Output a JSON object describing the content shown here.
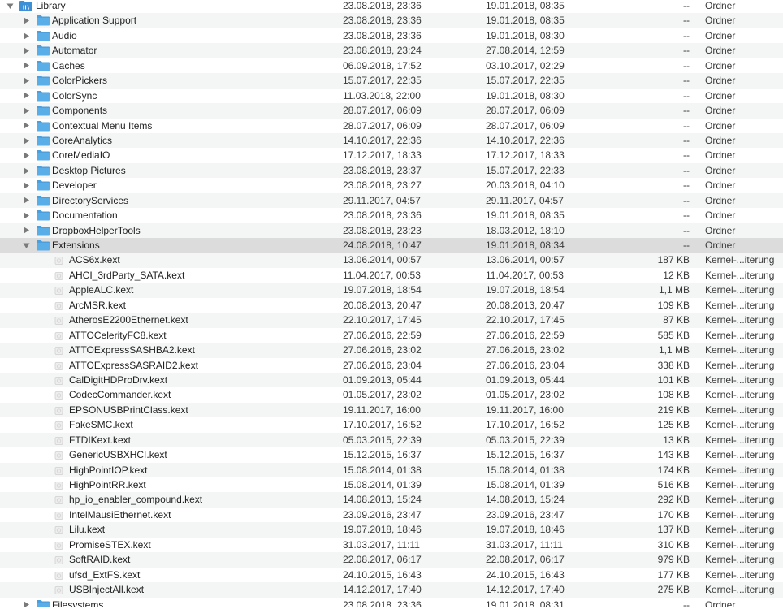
{
  "rows": [
    {
      "level": 0,
      "type": "folder",
      "expanded": true,
      "name": "Library",
      "modified": "23.08.2018, 23:36",
      "created": "19.01.2018, 08:35",
      "size": "--",
      "kind": "Ordner"
    },
    {
      "level": 1,
      "type": "folder",
      "expanded": false,
      "name": "Application Support",
      "modified": "23.08.2018, 23:36",
      "created": "19.01.2018, 08:35",
      "size": "--",
      "kind": "Ordner"
    },
    {
      "level": 1,
      "type": "folder",
      "expanded": false,
      "name": "Audio",
      "modified": "23.08.2018, 23:36",
      "created": "19.01.2018, 08:30",
      "size": "--",
      "kind": "Ordner"
    },
    {
      "level": 1,
      "type": "folder",
      "expanded": false,
      "name": "Automator",
      "modified": "23.08.2018, 23:24",
      "created": "27.08.2014, 12:59",
      "size": "--",
      "kind": "Ordner"
    },
    {
      "level": 1,
      "type": "folder",
      "expanded": false,
      "name": "Caches",
      "modified": "06.09.2018, 17:52",
      "created": "03.10.2017, 02:29",
      "size": "--",
      "kind": "Ordner"
    },
    {
      "level": 1,
      "type": "folder",
      "expanded": false,
      "name": "ColorPickers",
      "modified": "15.07.2017, 22:35",
      "created": "15.07.2017, 22:35",
      "size": "--",
      "kind": "Ordner"
    },
    {
      "level": 1,
      "type": "folder",
      "expanded": false,
      "name": "ColorSync",
      "modified": "11.03.2018, 22:00",
      "created": "19.01.2018, 08:30",
      "size": "--",
      "kind": "Ordner"
    },
    {
      "level": 1,
      "type": "folder",
      "expanded": false,
      "name": "Components",
      "modified": "28.07.2017, 06:09",
      "created": "28.07.2017, 06:09",
      "size": "--",
      "kind": "Ordner"
    },
    {
      "level": 1,
      "type": "folder",
      "expanded": false,
      "name": "Contextual Menu Items",
      "modified": "28.07.2017, 06:09",
      "created": "28.07.2017, 06:09",
      "size": "--",
      "kind": "Ordner"
    },
    {
      "level": 1,
      "type": "folder",
      "expanded": false,
      "name": "CoreAnalytics",
      "modified": "14.10.2017, 22:36",
      "created": "14.10.2017, 22:36",
      "size": "--",
      "kind": "Ordner"
    },
    {
      "level": 1,
      "type": "folder",
      "expanded": false,
      "name": "CoreMediaIO",
      "modified": "17.12.2017, 18:33",
      "created": "17.12.2017, 18:33",
      "size": "--",
      "kind": "Ordner"
    },
    {
      "level": 1,
      "type": "folder",
      "expanded": false,
      "name": "Desktop Pictures",
      "modified": "23.08.2018, 23:37",
      "created": "15.07.2017, 22:33",
      "size": "--",
      "kind": "Ordner"
    },
    {
      "level": 1,
      "type": "folder",
      "expanded": false,
      "name": "Developer",
      "modified": "23.08.2018, 23:27",
      "created": "20.03.2018, 04:10",
      "size": "--",
      "kind": "Ordner"
    },
    {
      "level": 1,
      "type": "folder",
      "expanded": false,
      "name": "DirectoryServices",
      "modified": "29.11.2017, 04:57",
      "created": "29.11.2017, 04:57",
      "size": "--",
      "kind": "Ordner"
    },
    {
      "level": 1,
      "type": "folder",
      "expanded": false,
      "name": "Documentation",
      "modified": "23.08.2018, 23:36",
      "created": "19.01.2018, 08:35",
      "size": "--",
      "kind": "Ordner"
    },
    {
      "level": 1,
      "type": "folder",
      "expanded": false,
      "name": "DropboxHelperTools",
      "modified": "23.08.2018, 23:23",
      "created": "18.03.2012, 18:10",
      "size": "--",
      "kind": "Ordner"
    },
    {
      "level": 1,
      "type": "folder",
      "expanded": true,
      "name": "Extensions",
      "modified": "24.08.2018, 10:47",
      "created": "19.01.2018, 08:34",
      "size": "--",
      "kind": "Ordner",
      "highlight": true
    },
    {
      "level": 2,
      "type": "kext",
      "name": "ACS6x.kext",
      "modified": "13.06.2014, 00:57",
      "created": "13.06.2014, 00:57",
      "size": "187 KB",
      "kind": "Kernel-...iterung"
    },
    {
      "level": 2,
      "type": "kext",
      "name": "AHCI_3rdParty_SATA.kext",
      "modified": "11.04.2017, 00:53",
      "created": "11.04.2017, 00:53",
      "size": "12 KB",
      "kind": "Kernel-...iterung"
    },
    {
      "level": 2,
      "type": "kext",
      "name": "AppleALC.kext",
      "modified": "19.07.2018, 18:54",
      "created": "19.07.2018, 18:54",
      "size": "1,1 MB",
      "kind": "Kernel-...iterung"
    },
    {
      "level": 2,
      "type": "kext",
      "name": "ArcMSR.kext",
      "modified": "20.08.2013, 20:47",
      "created": "20.08.2013, 20:47",
      "size": "109 KB",
      "kind": "Kernel-...iterung"
    },
    {
      "level": 2,
      "type": "kext",
      "name": "AtherosE2200Ethernet.kext",
      "modified": "22.10.2017, 17:45",
      "created": "22.10.2017, 17:45",
      "size": "87 KB",
      "kind": "Kernel-...iterung"
    },
    {
      "level": 2,
      "type": "kext",
      "name": "ATTOCelerityFC8.kext",
      "modified": "27.06.2016, 22:59",
      "created": "27.06.2016, 22:59",
      "size": "585 KB",
      "kind": "Kernel-...iterung"
    },
    {
      "level": 2,
      "type": "kext",
      "name": "ATTOExpressSASHBA2.kext",
      "modified": "27.06.2016, 23:02",
      "created": "27.06.2016, 23:02",
      "size": "1,1 MB",
      "kind": "Kernel-...iterung"
    },
    {
      "level": 2,
      "type": "kext",
      "name": "ATTOExpressSASRAID2.kext",
      "modified": "27.06.2016, 23:04",
      "created": "27.06.2016, 23:04",
      "size": "338 KB",
      "kind": "Kernel-...iterung"
    },
    {
      "level": 2,
      "type": "kext",
      "name": "CalDigitHDProDrv.kext",
      "modified": "01.09.2013, 05:44",
      "created": "01.09.2013, 05:44",
      "size": "101 KB",
      "kind": "Kernel-...iterung"
    },
    {
      "level": 2,
      "type": "kext",
      "name": "CodecCommander.kext",
      "modified": "01.05.2017, 23:02",
      "created": "01.05.2017, 23:02",
      "size": "108 KB",
      "kind": "Kernel-...iterung"
    },
    {
      "level": 2,
      "type": "kext",
      "name": "EPSONUSBPrintClass.kext",
      "modified": "19.11.2017, 16:00",
      "created": "19.11.2017, 16:00",
      "size": "219 KB",
      "kind": "Kernel-...iterung"
    },
    {
      "level": 2,
      "type": "kext",
      "name": "FakeSMC.kext",
      "modified": "17.10.2017, 16:52",
      "created": "17.10.2017, 16:52",
      "size": "125 KB",
      "kind": "Kernel-...iterung"
    },
    {
      "level": 2,
      "type": "kext",
      "name": "FTDIKext.kext",
      "modified": "05.03.2015, 22:39",
      "created": "05.03.2015, 22:39",
      "size": "13 KB",
      "kind": "Kernel-...iterung"
    },
    {
      "level": 2,
      "type": "kext",
      "name": "GenericUSBXHCI.kext",
      "modified": "15.12.2015, 16:37",
      "created": "15.12.2015, 16:37",
      "size": "143 KB",
      "kind": "Kernel-...iterung"
    },
    {
      "level": 2,
      "type": "kext",
      "name": "HighPointIOP.kext",
      "modified": "15.08.2014, 01:38",
      "created": "15.08.2014, 01:38",
      "size": "174 KB",
      "kind": "Kernel-...iterung"
    },
    {
      "level": 2,
      "type": "kext",
      "name": "HighPointRR.kext",
      "modified": "15.08.2014, 01:39",
      "created": "15.08.2014, 01:39",
      "size": "516 KB",
      "kind": "Kernel-...iterung"
    },
    {
      "level": 2,
      "type": "kext",
      "name": "hp_io_enabler_compound.kext",
      "modified": "14.08.2013, 15:24",
      "created": "14.08.2013, 15:24",
      "size": "292 KB",
      "kind": "Kernel-...iterung"
    },
    {
      "level": 2,
      "type": "kext",
      "name": "IntelMausiEthernet.kext",
      "modified": "23.09.2016, 23:47",
      "created": "23.09.2016, 23:47",
      "size": "170 KB",
      "kind": "Kernel-...iterung"
    },
    {
      "level": 2,
      "type": "kext",
      "name": "Lilu.kext",
      "modified": "19.07.2018, 18:46",
      "created": "19.07.2018, 18:46",
      "size": "137 KB",
      "kind": "Kernel-...iterung"
    },
    {
      "level": 2,
      "type": "kext",
      "name": "PromiseSTEX.kext",
      "modified": "31.03.2017, 11:11",
      "created": "31.03.2017, 11:11",
      "size": "310 KB",
      "kind": "Kernel-...iterung"
    },
    {
      "level": 2,
      "type": "kext",
      "name": "SoftRAID.kext",
      "modified": "22.08.2017, 06:17",
      "created": "22.08.2017, 06:17",
      "size": "979 KB",
      "kind": "Kernel-...iterung"
    },
    {
      "level": 2,
      "type": "kext",
      "name": "ufsd_ExtFS.kext",
      "modified": "24.10.2015, 16:43",
      "created": "24.10.2015, 16:43",
      "size": "177 KB",
      "kind": "Kernel-...iterung"
    },
    {
      "level": 2,
      "type": "kext",
      "name": "USBInjectAll.kext",
      "modified": "14.12.2017, 17:40",
      "created": "14.12.2017, 17:40",
      "size": "275 KB",
      "kind": "Kernel-...iterung"
    },
    {
      "level": 1,
      "type": "folder",
      "expanded": false,
      "name": "Filesystems",
      "modified": "23.08.2018, 23:36",
      "created": "19.01.2018, 08:31",
      "size": "--",
      "kind": "Ordner"
    }
  ],
  "colors": {
    "folder": "#5aaee8",
    "folder_tab": "#4a9fdc",
    "library_folder": "#3d8fd6",
    "disclosure": "#7a7a7a",
    "alt_row": "#f4f5f5",
    "highlight_row": "#dcdcdc"
  },
  "icons": {
    "folder": "folder-icon",
    "library": "library-folder-icon",
    "kext": "kext-icon",
    "expanded": "disclosure-triangle-down-icon",
    "collapsed": "disclosure-triangle-right-icon"
  }
}
